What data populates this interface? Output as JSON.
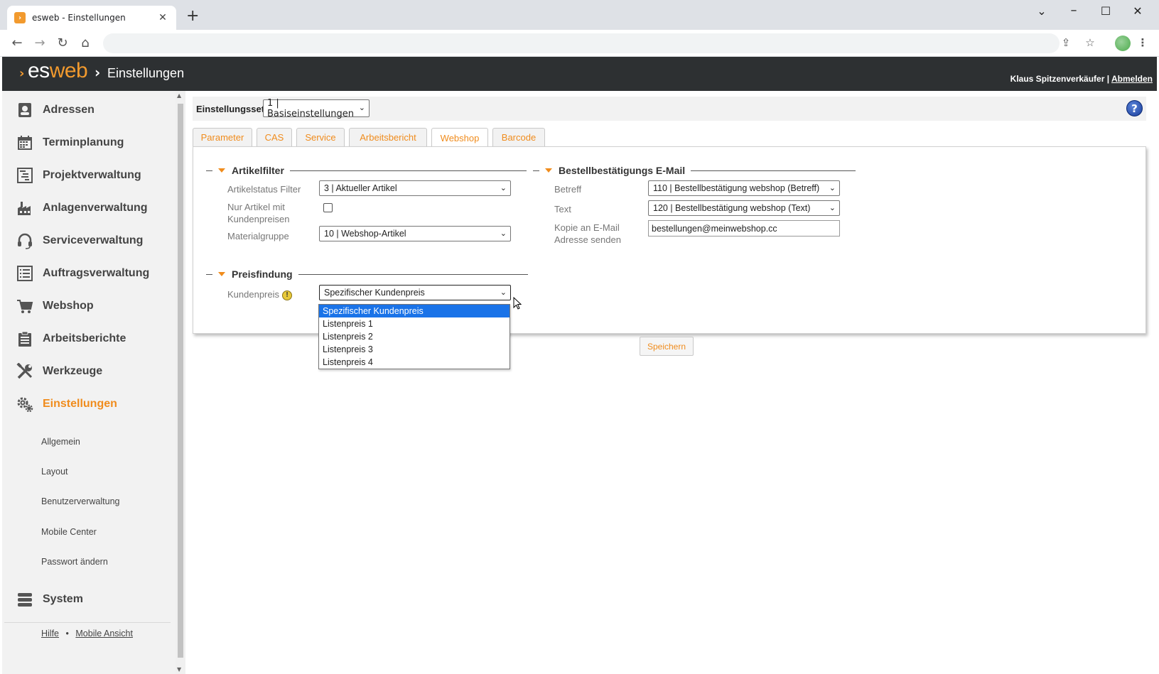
{
  "browser": {
    "tab_title": "esweb - Einstellungen",
    "tab_favicon": "esweb-favicon",
    "address": ""
  },
  "header": {
    "logo_es": "es",
    "logo_web": "web",
    "crumb_sep": "›",
    "page_title": "Einstellungen",
    "user_name": "Klaus Spitzenverkäufer",
    "separator": "|",
    "logout": "Abmelden"
  },
  "sidebar": {
    "items": [
      {
        "label": "Adressen",
        "icon": "address-book-icon"
      },
      {
        "label": "Terminplanung",
        "icon": "calendar-icon"
      },
      {
        "label": "Projektverwaltung",
        "icon": "gantt-icon"
      },
      {
        "label": "Anlagenverwaltung",
        "icon": "factory-icon"
      },
      {
        "label": "Serviceverwaltung",
        "icon": "headset-icon"
      },
      {
        "label": "Auftragsverwaltung",
        "icon": "list-icon"
      },
      {
        "label": "Webshop",
        "icon": "cart-icon"
      },
      {
        "label": "Arbeitsberichte",
        "icon": "clipboard-icon"
      },
      {
        "label": "Werkzeuge",
        "icon": "tools-icon"
      },
      {
        "label": "Einstellungen",
        "icon": "gears-icon",
        "active": true
      },
      {
        "label": "System",
        "icon": "database-icon"
      }
    ],
    "subitems": [
      "Allgemein",
      "Layout",
      "Benutzerverwaltung",
      "Mobile Center",
      "Passwort ändern"
    ],
    "footer": {
      "help": "Hilfe",
      "dot": "•",
      "mobile": "Mobile Ansicht"
    }
  },
  "settings_set": {
    "label": "Einstellungsset",
    "value": "1 | Basiseinstellungen"
  },
  "tabs": [
    "Parameter",
    "CAS",
    "Service",
    "Arbeitsbericht",
    "Webshop",
    "Barcode"
  ],
  "active_tab": "Webshop",
  "artikelfilter": {
    "title": "Artikelfilter",
    "status_label": "Artikelstatus Filter",
    "status_value": "3 | Aktueller Artikel",
    "nur_label_1": "Nur Artikel mit",
    "nur_label_2": "Kundenpreisen",
    "nur_checked": false,
    "material_label": "Materialgruppe",
    "material_value": "10 | Webshop-Artikel"
  },
  "preisfindung": {
    "title": "Preisfindung",
    "kundenpreis_label": "Kundenpreis",
    "kundenpreis_value": "Spezifischer Kundenpreis",
    "options": [
      "Spezifischer Kundenpreis",
      "Listenpreis 1",
      "Listenpreis 2",
      "Listenpreis 3",
      "Listenpreis 4"
    ]
  },
  "bestell": {
    "title": "Bestellbestätigungs E-Mail",
    "betreff_label": "Betreff",
    "betreff_value": "110 | Bestellbestätigung webshop (Betreff)",
    "text_label": "Text",
    "text_value": "120 | Bestellbestätigung webshop (Text)",
    "kopie_label_1": "Kopie an E-Mail",
    "kopie_label_2": "Adresse senden",
    "kopie_value": "bestellungen@meinwebshop.cc"
  },
  "save_label": "Speichern",
  "colors": {
    "accent": "#f08c1d",
    "header_bg": "#2d3032",
    "selection": "#1a73e8"
  }
}
